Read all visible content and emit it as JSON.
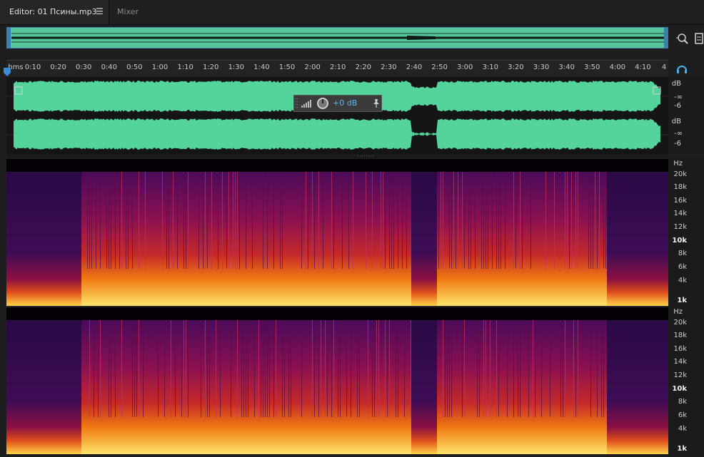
{
  "tabs": {
    "editor_label": "Editor: 01 Псины.mp3",
    "editor_menu_icon": "hamburger-icon",
    "mixer_label": "Mixer"
  },
  "ruler": {
    "unit": "hms",
    "ticks": [
      "0:10",
      "0:20",
      "0:30",
      "0:40",
      "0:50",
      "1:00",
      "1:10",
      "1:20",
      "1:30",
      "1:40",
      "1:50",
      "2:00",
      "2:10",
      "2:20",
      "2:30",
      "2:40",
      "2:50",
      "3:00",
      "3:10",
      "3:20",
      "3:30",
      "3:40",
      "3:50",
      "4:00",
      "4:10",
      "4"
    ]
  },
  "hud": {
    "value": "+0 dB",
    "icons": [
      "level-meter-icon",
      "volume-knob-icon",
      "pin-icon"
    ]
  },
  "channel_db": {
    "ch1": [
      "dB",
      "-∞",
      "-6"
    ],
    "ch2": [
      "dB",
      "-∞",
      "-6"
    ]
  },
  "spectral_scale": {
    "unit": "Hz",
    "labels": [
      "20k",
      "18k",
      "16k",
      "14k",
      "12k",
      "10k",
      "8k",
      "6k",
      "4k",
      "1k"
    ]
  },
  "colors": {
    "waveform": "#54d39c",
    "selection_handle": "#3f7db0",
    "accent": "#5fb3e8"
  }
}
